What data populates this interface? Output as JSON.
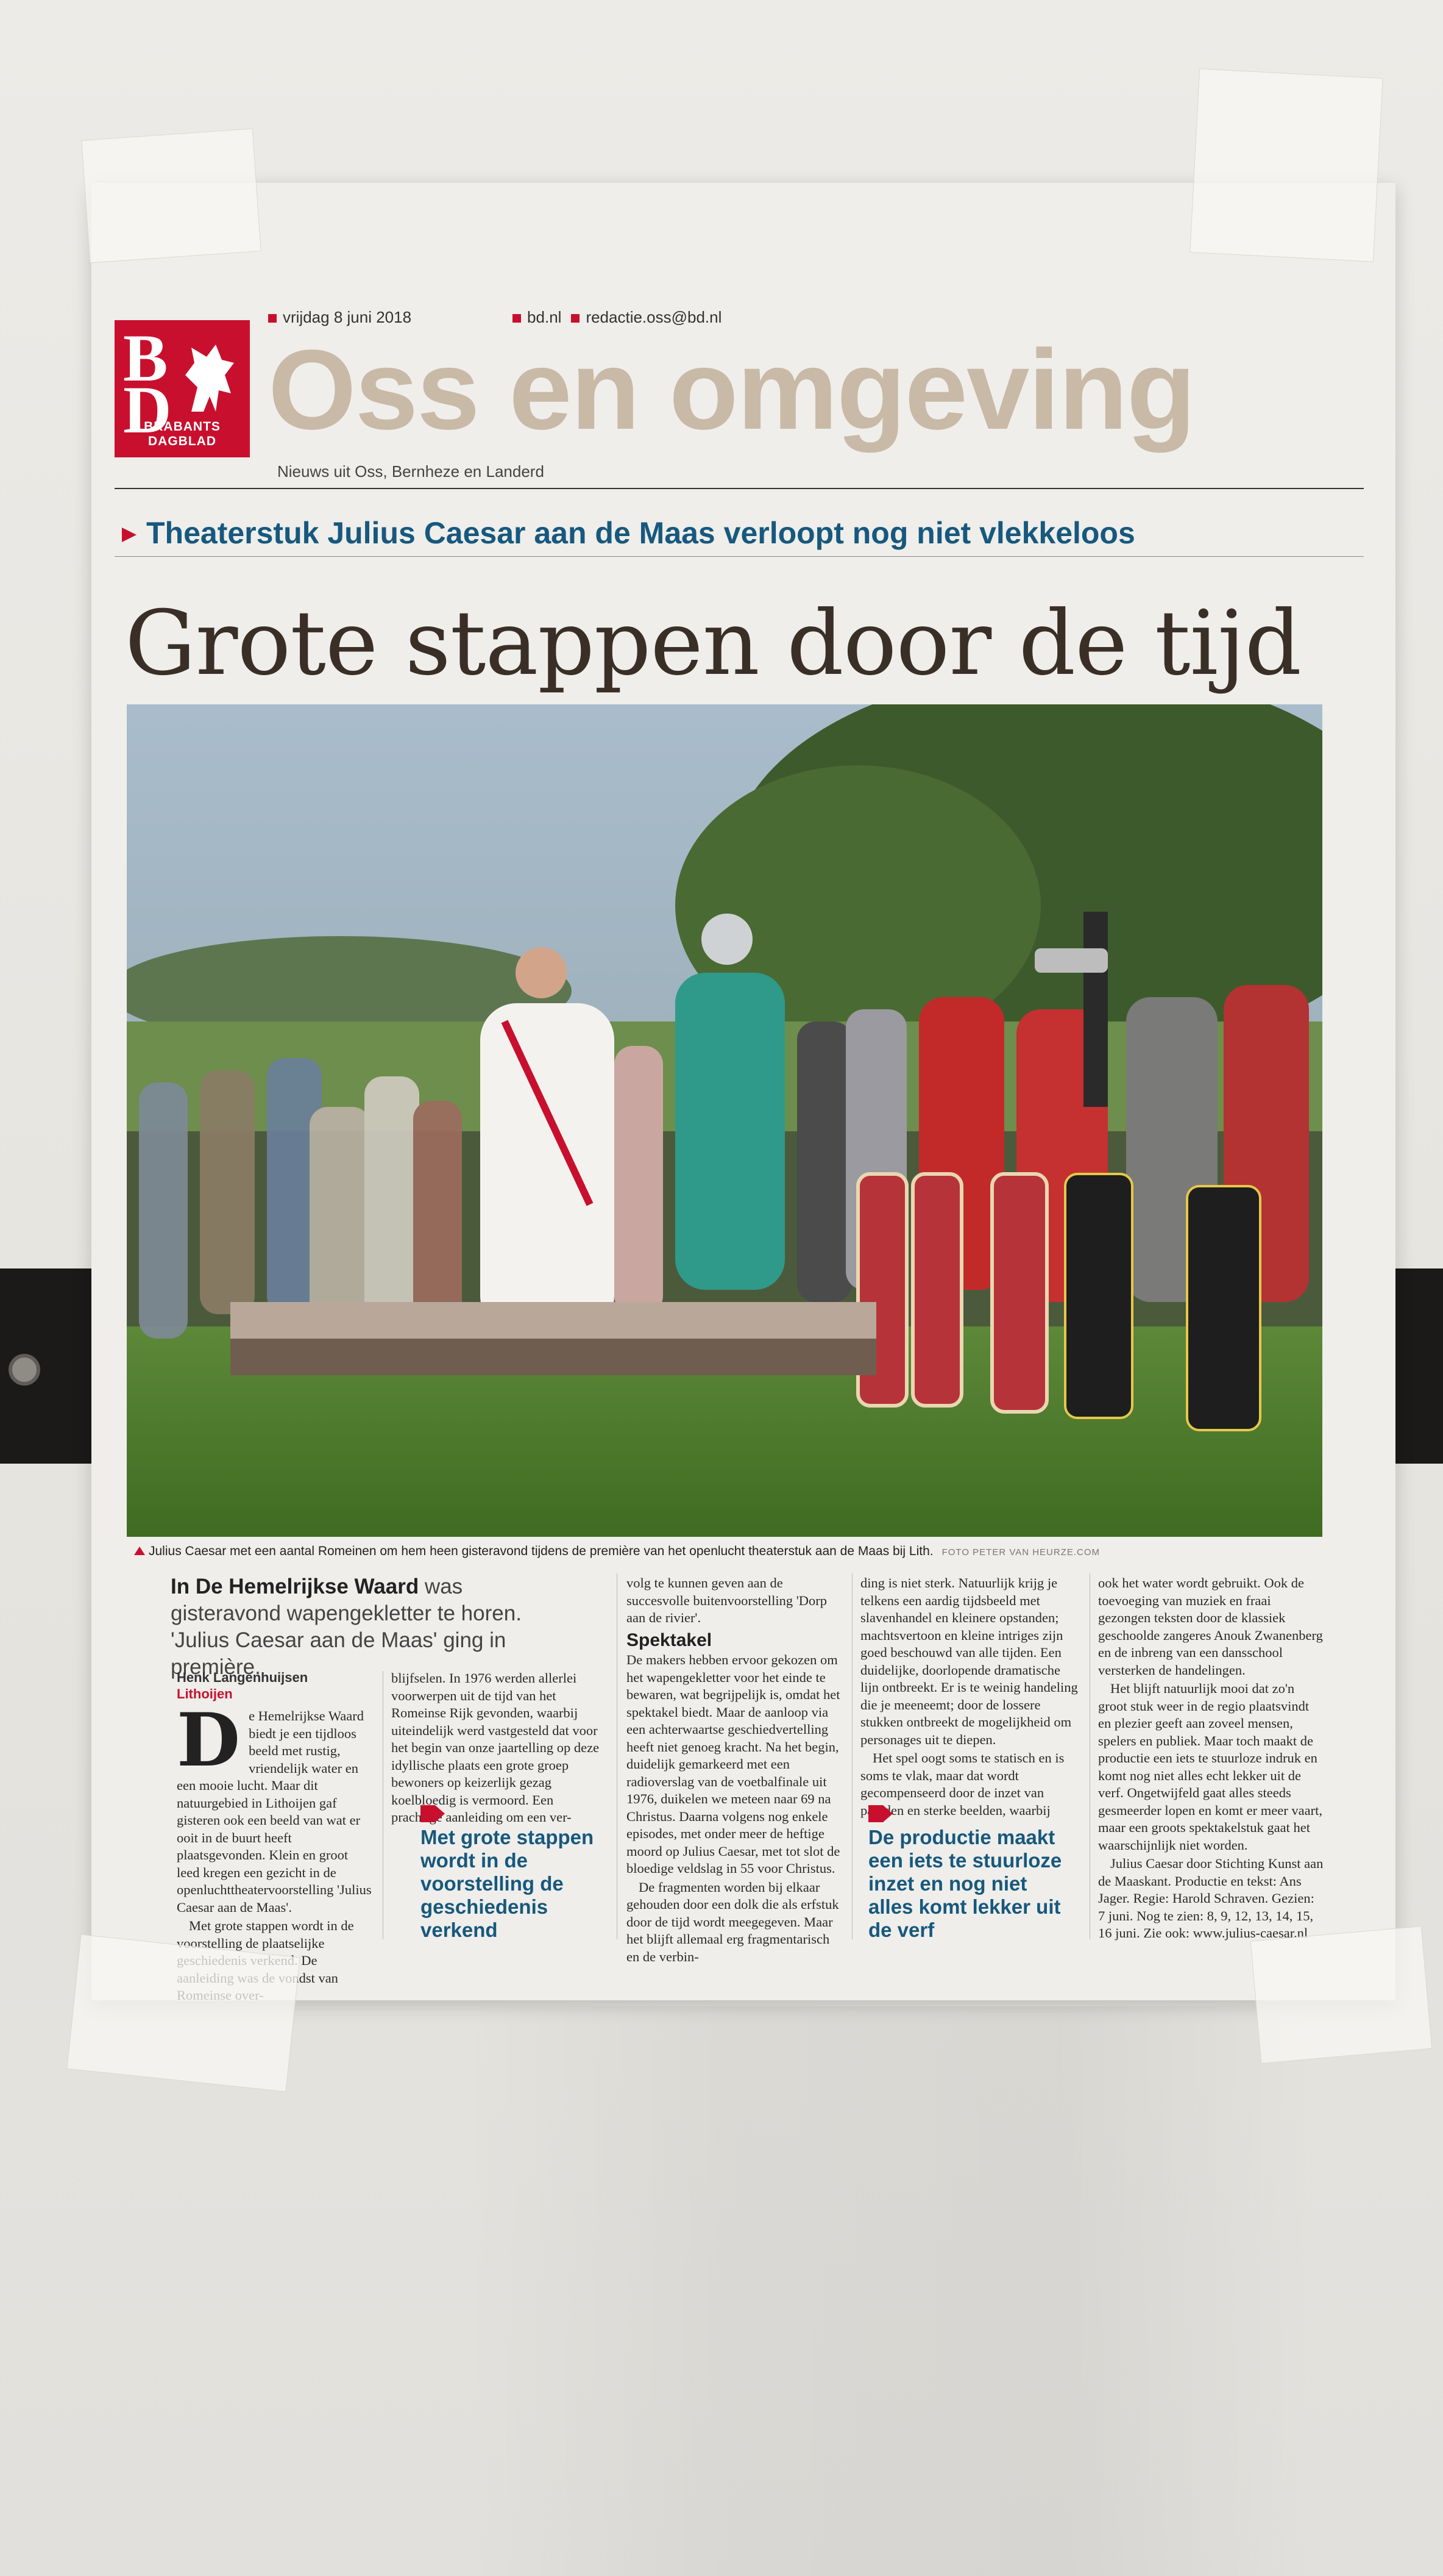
{
  "header": {
    "date": "vrijdag 8 juni 2018",
    "site": "bd.nl",
    "email": "redactie.oss@bd.nl",
    "logo_letters_line1": "B",
    "logo_letters_line2": "D",
    "logo_caption": "BRABANTS DAGBLAD",
    "section_title": "Oss en omgeving",
    "section_subtitle": "Nieuws uit Oss, Bernheze en Landerd"
  },
  "article": {
    "kicker": "Theaterstuk Julius Caesar aan de Maas verloopt nog niet vlekkeloos",
    "headline": "Grote stappen door de tijd",
    "photo_caption": "Julius Caesar met een aantal Romeinen om hem heen gisteravond tijdens de première van het openlucht theaterstuk aan de Maas bij Lith.",
    "photo_credit": "FOTO PETER VAN HEURZE.COM",
    "intro_bold": "In De Hemelrijkse Waard",
    "intro_rest": " was gisteravond wapengekletter te horen. 'Julius Caesar aan de Maas' ging in première.",
    "author": "Henk Langenhuijsen",
    "location": "Lithoijen",
    "dropcap": "D",
    "col1": [
      "e Hemelrijkse Waard biedt je een tijdloos beeld met rustig, vriendelijk water en een mooie lucht. Maar dit natuurgebied in Lithoijen gaf gisteren ook een beeld van wat er ooit in de buurt heeft plaatsgevonden. Klein en groot leed kregen een gezicht in de openluchttheatervoorstelling 'Julius Caesar aan de Maas'.",
      "Met grote stappen wordt in de voorstelling de plaatselijke geschiedenis verkend. De aanleiding was de vondst van Romeinse over-"
    ],
    "col2": [
      "blijfselen. In 1976 werden allerlei voorwerpen uit de tijd van het Romeinse Rijk gevonden, waarbij uiteindelijk werd vastgesteld dat voor het begin van onze jaartelling op deze idyllische plaats een grote groep bewoners op keizerlijk gezag koelbloedig is vermoord. Een prachtige aanleiding om een ver-"
    ],
    "quote1": "Met grote stappen wordt in de voorstelling de geschiedenis verkend",
    "col3a": "volg te kunnen geven aan de succesvolle buitenvoorstelling 'Dorp aan de rivier'.",
    "subhead": "Spektakel",
    "col3b": [
      "De makers hebben ervoor gekozen om het wapengekletter voor het einde te bewaren, wat begrijpelijk is, omdat het spektakel biedt. Maar de aanloop via een achterwaartse geschiedvertelling heeft niet genoeg kracht. Na het begin, duidelijk gemarkeerd met een radioverslag van de voetbalfinale uit 1976, duikelen we meteen naar 69 na Christus. Daarna volgens nog enkele episodes, met onder meer de heftige moord op Julius Caesar, met tot slot de bloedige veldslag in 55 voor Christus.",
      "De fragmenten worden bij elkaar gehouden door een dolk die als erfstuk door de tijd wordt meegegeven. Maar het blijft allemaal erg fragmentarisch en de verbin-"
    ],
    "col4": [
      "ding is niet sterk. Natuurlijk krijg je telkens een aardig tijdsbeeld met slavenhandel en kleinere opstanden; machtsvertoon en kleine intriges zijn goed beschouwd van alle tijden. Een duidelijke, doorlopende dramatische lijn ontbreekt. Er is te weinig handeling die je meeneemt; door de lossere stukken ontbreekt de mogelijkheid om personages uit te diepen.",
      "Het spel oogt soms te statisch en is soms te vlak, maar dat wordt gecompenseerd door de inzet van paarden en sterke beelden, waarbij"
    ],
    "quote2": "De productie maakt een iets te stuurloze inzet en nog niet alles komt lekker uit de verf",
    "col5": [
      "ook het water wordt gebruikt. Ook de toevoeging van muziek en fraai gezongen teksten door de klassiek geschoolde zangeres Anouk Zwanenberg en de inbreng van een dansschool versterken de handelingen.",
      "Het blijft natuurlijk mooi dat zo'n groot stuk weer in de regio plaatsvindt en plezier geeft aan zoveel mensen, spelers en publiek. Maar toch maakt de productie een iets te stuurloze indruk en komt nog niet alles echt lekker uit de verf. Ongetwijfeld gaat alles steeds gesmeerder lopen en komt er meer vaart, maar een groots spektakelstuk gaat het waarschijnlijk niet worden.",
      "Julius Caesar door Stichting Kunst aan de Maaskant. Productie en tekst: Ans Jager. Regie: Harold Schraven. Gezien: 7 juni. Nog te zien: 8, 9, 12, 13, 14, 15, 16 juni. Zie ook: www.julius-caesar.nl"
    ]
  },
  "colors": {
    "brand_red": "#c8102e",
    "kicker_blue": "#17587e",
    "masthead_beige": "#c9b9a7"
  }
}
